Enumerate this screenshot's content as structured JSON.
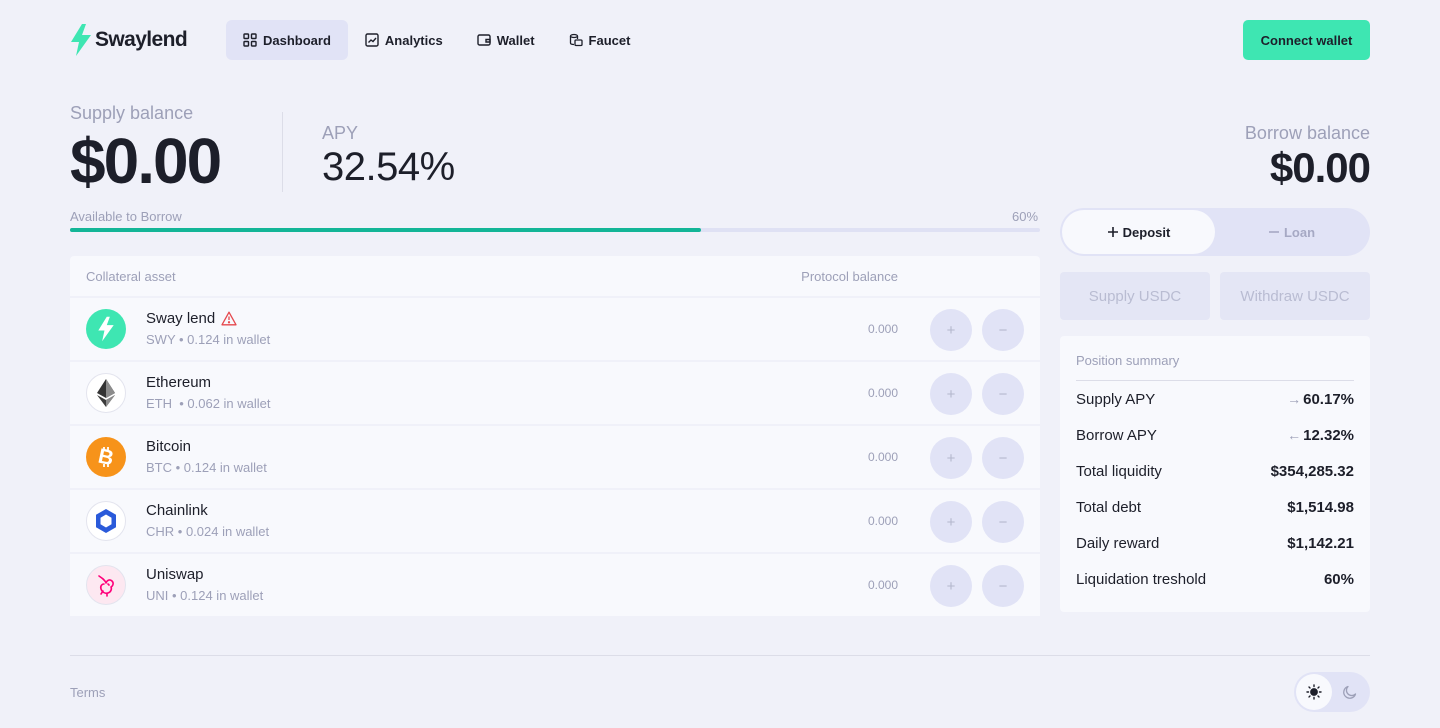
{
  "brand": {
    "name": "Swaylend",
    "accent": "#3ee6b2"
  },
  "nav": {
    "items": [
      {
        "label": "Dashboard",
        "icon": "grid-icon",
        "active": true
      },
      {
        "label": "Analytics",
        "icon": "chart-icon",
        "active": false
      },
      {
        "label": "Wallet",
        "icon": "wallet-icon",
        "active": false
      },
      {
        "label": "Faucet",
        "icon": "coins-icon",
        "active": false
      }
    ],
    "connect_label": "Connect wallet"
  },
  "stats": {
    "supply_label": "Supply balance",
    "supply_value": "$0.00",
    "apy_label": "APY",
    "apy_value": "32.54%",
    "borrow_label": "Borrow balance",
    "borrow_value": "$0.00"
  },
  "availability": {
    "label": "Available to Borrow",
    "percent_text": "60%",
    "fill_fraction": 0.65
  },
  "table": {
    "headers": {
      "asset": "Collateral asset",
      "balance": "Protocol balance"
    },
    "rows": [
      {
        "name": "Sway lend",
        "sub": "SWY • 0.124 in wallet",
        "balance": "0.000",
        "icon": "swaylend-logo-icon",
        "warning": true
      },
      {
        "name": "Ethereum",
        "sub": "ETH  • 0.062 in wallet",
        "balance": "0.000",
        "icon": "ethereum-logo-icon",
        "warning": false
      },
      {
        "name": "Bitcoin",
        "sub": "BTC • 0.124 in wallet",
        "balance": "0.000",
        "icon": "bitcoin-logo-icon",
        "warning": false
      },
      {
        "name": "Chainlink",
        "sub": "CHR • 0.024 in wallet",
        "balance": "0.000",
        "icon": "chainlink-logo-icon",
        "warning": false
      },
      {
        "name": "Uniswap",
        "sub": "UNI • 0.124 in wallet",
        "balance": "0.000",
        "icon": "uniswap-logo-icon",
        "warning": false
      }
    ],
    "plus_symbol": "+",
    "minus_symbol": "−"
  },
  "actions": {
    "deposit_label": "Deposit",
    "loan_label": "Loan",
    "supply_label": "Supply USDC",
    "withdraw_label": "Withdraw USDC"
  },
  "summary": {
    "title": "Position summary",
    "rows": [
      {
        "label": "Supply APY",
        "value": "60.17%",
        "arrow": "→"
      },
      {
        "label": "Borrow APY",
        "value": "12.32%",
        "arrow": "←"
      },
      {
        "label": "Total liquidity",
        "value": "$354,285.32",
        "arrow": ""
      },
      {
        "label": "Total debt",
        "value": "$1,514.98",
        "arrow": ""
      },
      {
        "label": "Daily reward",
        "value": "$1,142.21",
        "arrow": ""
      },
      {
        "label": "Liquidation treshold",
        "value": "60%",
        "arrow": ""
      }
    ]
  },
  "footer": {
    "terms_label": "Terms"
  }
}
